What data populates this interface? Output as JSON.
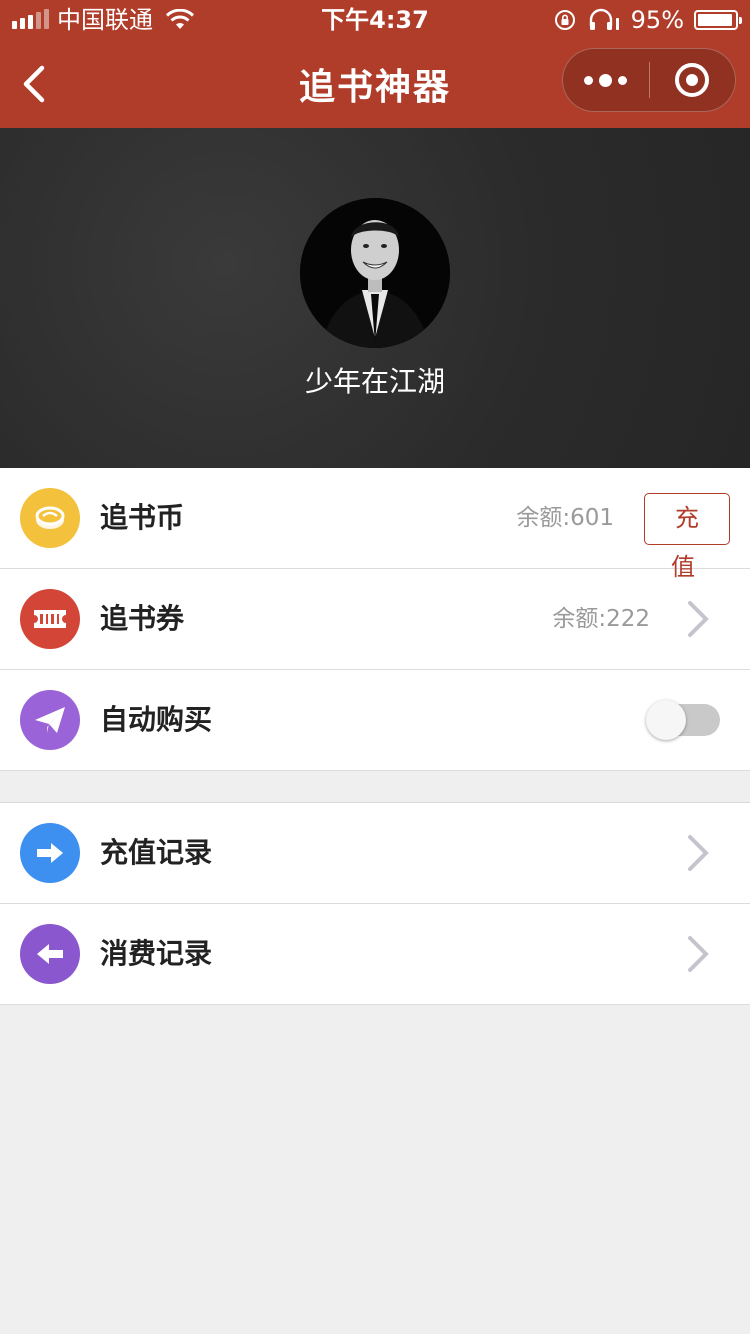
{
  "status_bar": {
    "carrier": "中国联通",
    "time": "下午4:37",
    "battery": "95%"
  },
  "nav": {
    "title": "追书神器"
  },
  "profile": {
    "username": "少年在江湖"
  },
  "account_items": [
    {
      "label": "追书币",
      "value": "余额:601",
      "action": "充 值",
      "icon": "coin-icon",
      "color": "#f4c13d"
    },
    {
      "label": "追书券",
      "value": "余额:222",
      "icon": "ticket-icon",
      "color": "#d34536"
    },
    {
      "label": "自动购买",
      "toggle": false,
      "icon": "paper-plane-icon",
      "color": "#9a63d8"
    }
  ],
  "record_items": [
    {
      "label": "充值记录",
      "icon": "arrow-right-icon",
      "color": "#3d8ff0"
    },
    {
      "label": "消费记录",
      "icon": "arrow-left-icon",
      "color": "#8b57cf"
    }
  ],
  "colors": {
    "brand": "#b03c2a",
    "background": "#efefef"
  }
}
